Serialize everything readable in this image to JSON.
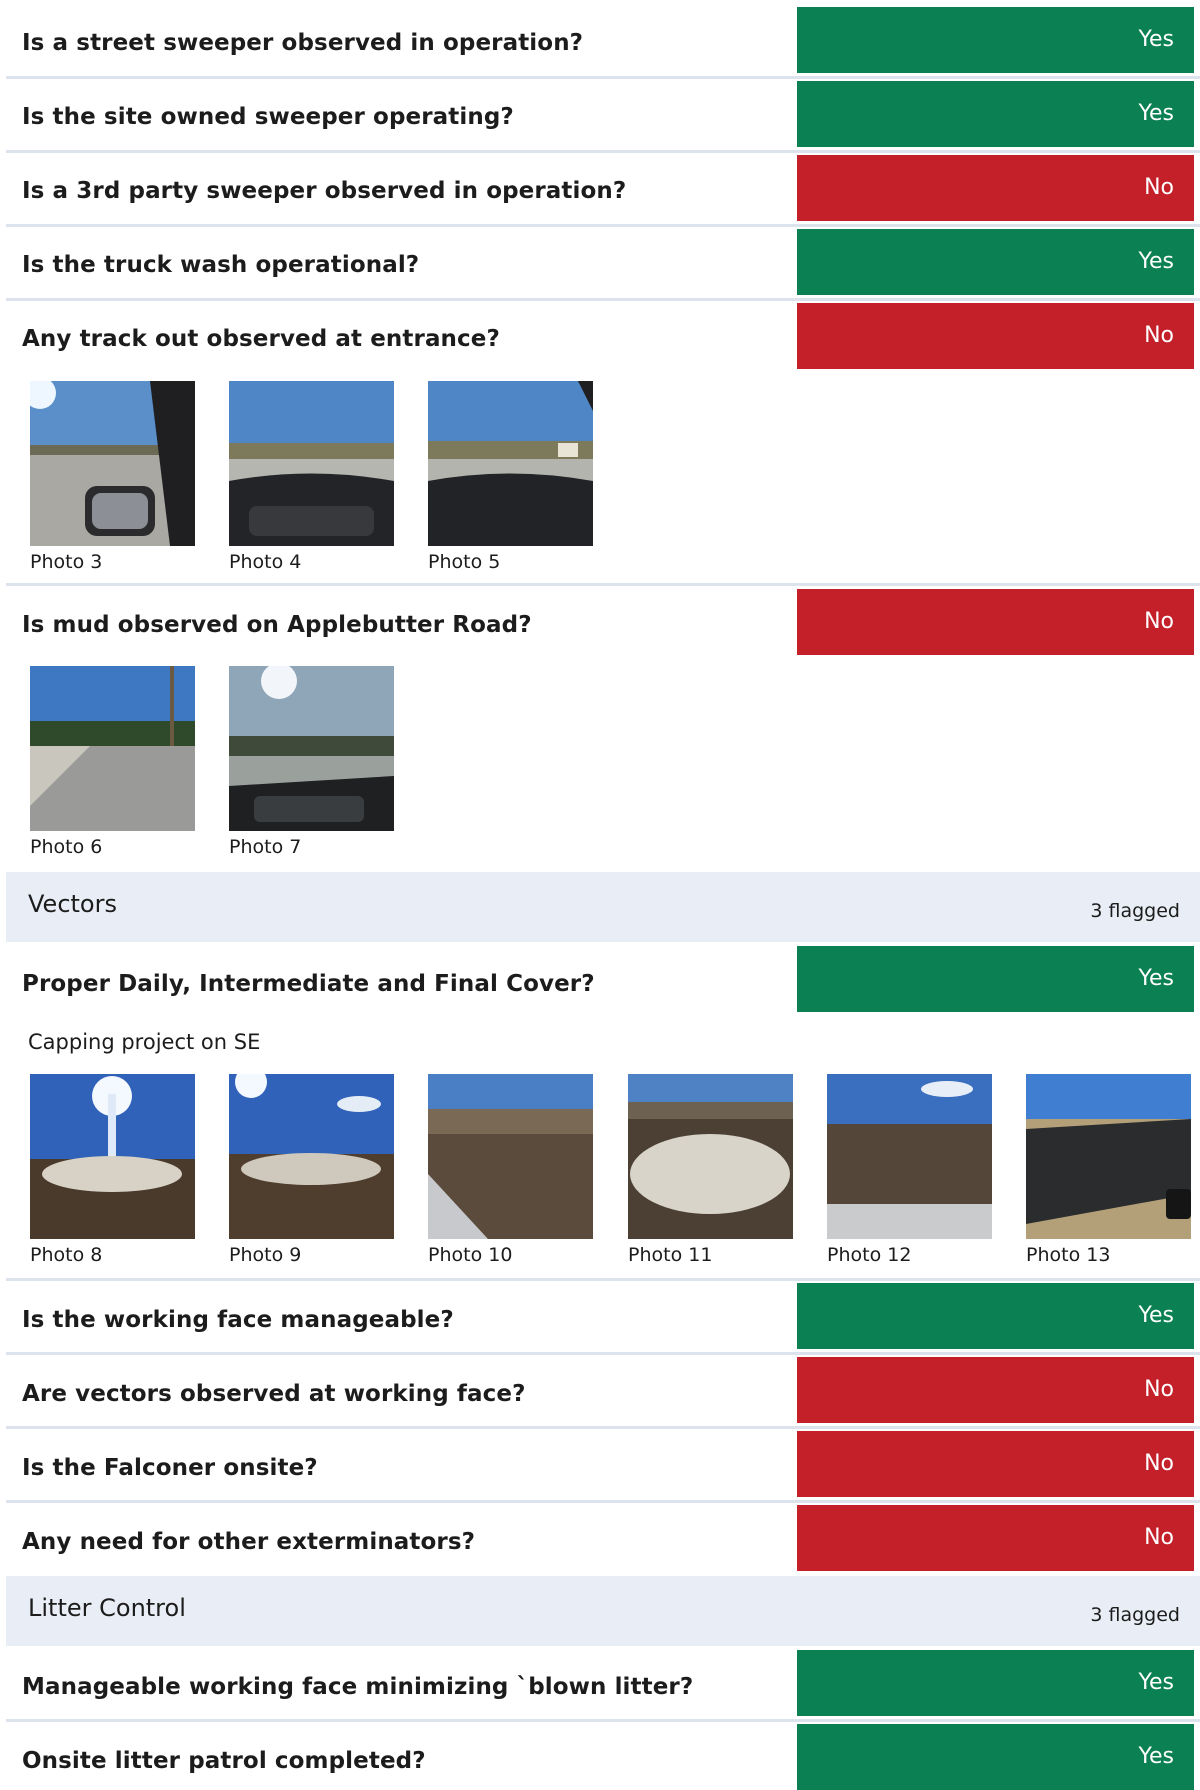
{
  "colors": {
    "yes": "#0b8153",
    "no": "#c4202a",
    "section_bg": "#e9eef6",
    "divider": "#dde3ec"
  },
  "questions": [
    {
      "label": "Is a street sweeper observed in operation?",
      "answer": "Yes",
      "status": "yes"
    },
    {
      "label": "Is the site owned sweeper operating?",
      "answer": "Yes",
      "status": "yes"
    },
    {
      "label": "Is a 3rd party sweeper observed in operation?",
      "answer": "No",
      "status": "no"
    },
    {
      "label": "Is the truck wash operational?",
      "answer": "Yes",
      "status": "yes"
    },
    {
      "label": "Any track out observed at entrance?",
      "answer": "No",
      "status": "no"
    },
    {
      "label": "Is mud observed on Applebutter Road?",
      "answer": "No",
      "status": "no"
    },
    {
      "label": "Proper Daily, Intermediate and Final Cover?",
      "answer": "Yes",
      "status": "yes"
    },
    {
      "label": "Is the working face manageable?",
      "answer": "Yes",
      "status": "yes"
    },
    {
      "label": "Are vectors observed at working face?",
      "answer": "No",
      "status": "no"
    },
    {
      "label": "Is the Falconer onsite?",
      "answer": "No",
      "status": "no"
    },
    {
      "label": "Any need for other exterminators?",
      "answer": "No",
      "status": "no"
    },
    {
      "label": "Manageable working face minimizing `blown litter?",
      "answer": "Yes",
      "status": "yes"
    },
    {
      "label": "Onsite litter patrol completed?",
      "answer": "Yes",
      "status": "yes"
    }
  ],
  "sections": [
    {
      "title": "Vectors",
      "flagged": "3 flagged"
    },
    {
      "title": "Litter Control",
      "flagged": "3 flagged"
    }
  ],
  "notes": {
    "capping": "Capping project on SE"
  },
  "photos": {
    "track_out": [
      {
        "caption": "Photo 3",
        "scene": "car-mirror"
      },
      {
        "caption": "Photo 4",
        "scene": "dashboard"
      },
      {
        "caption": "Photo 5",
        "scene": "dashboard"
      }
    ],
    "mud": [
      {
        "caption": "Photo 6",
        "scene": "road"
      },
      {
        "caption": "Photo 7",
        "scene": "windshield"
      }
    ],
    "cover": [
      {
        "caption": "Photo 8",
        "scene": "dirt-sun"
      },
      {
        "caption": "Photo 9",
        "scene": "dirt-sun"
      },
      {
        "caption": "Photo 10",
        "scene": "dirt"
      },
      {
        "caption": "Photo 11",
        "scene": "dirt-light"
      },
      {
        "caption": "Photo 12",
        "scene": "dirt"
      },
      {
        "caption": "Photo 13",
        "scene": "tarp"
      }
    ]
  }
}
